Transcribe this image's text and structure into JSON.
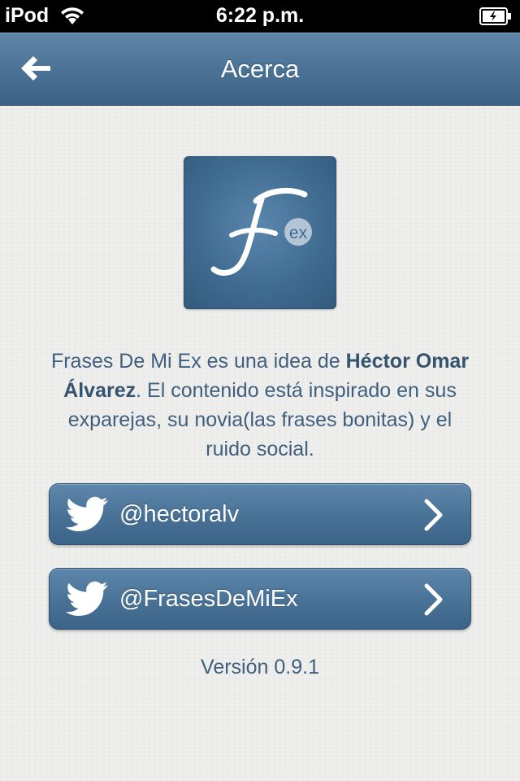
{
  "status_bar": {
    "carrier": "iPod",
    "time": "6:22 p.m."
  },
  "nav": {
    "title": "Acerca",
    "back_icon": "arrow-left-icon"
  },
  "logo": {
    "letter": "F",
    "badge": "ex"
  },
  "description": {
    "part1": "Frases De Mi Ex es una idea de ",
    "author": "Héctor Omar Álvarez",
    "part2": ". El contenido está inspirado en sus exparejas, su novia(las frases bonitas) y el ruido social."
  },
  "buttons": [
    {
      "label": "@hectoralv",
      "icon": "twitter-bird-icon"
    },
    {
      "label": "@FrasesDeMiEx",
      "icon": "twitter-bird-icon"
    }
  ],
  "version": "Versión 0.9.1",
  "colors": {
    "accent": "#4a7398",
    "text": "#3e5f7d",
    "background": "#efefed"
  }
}
